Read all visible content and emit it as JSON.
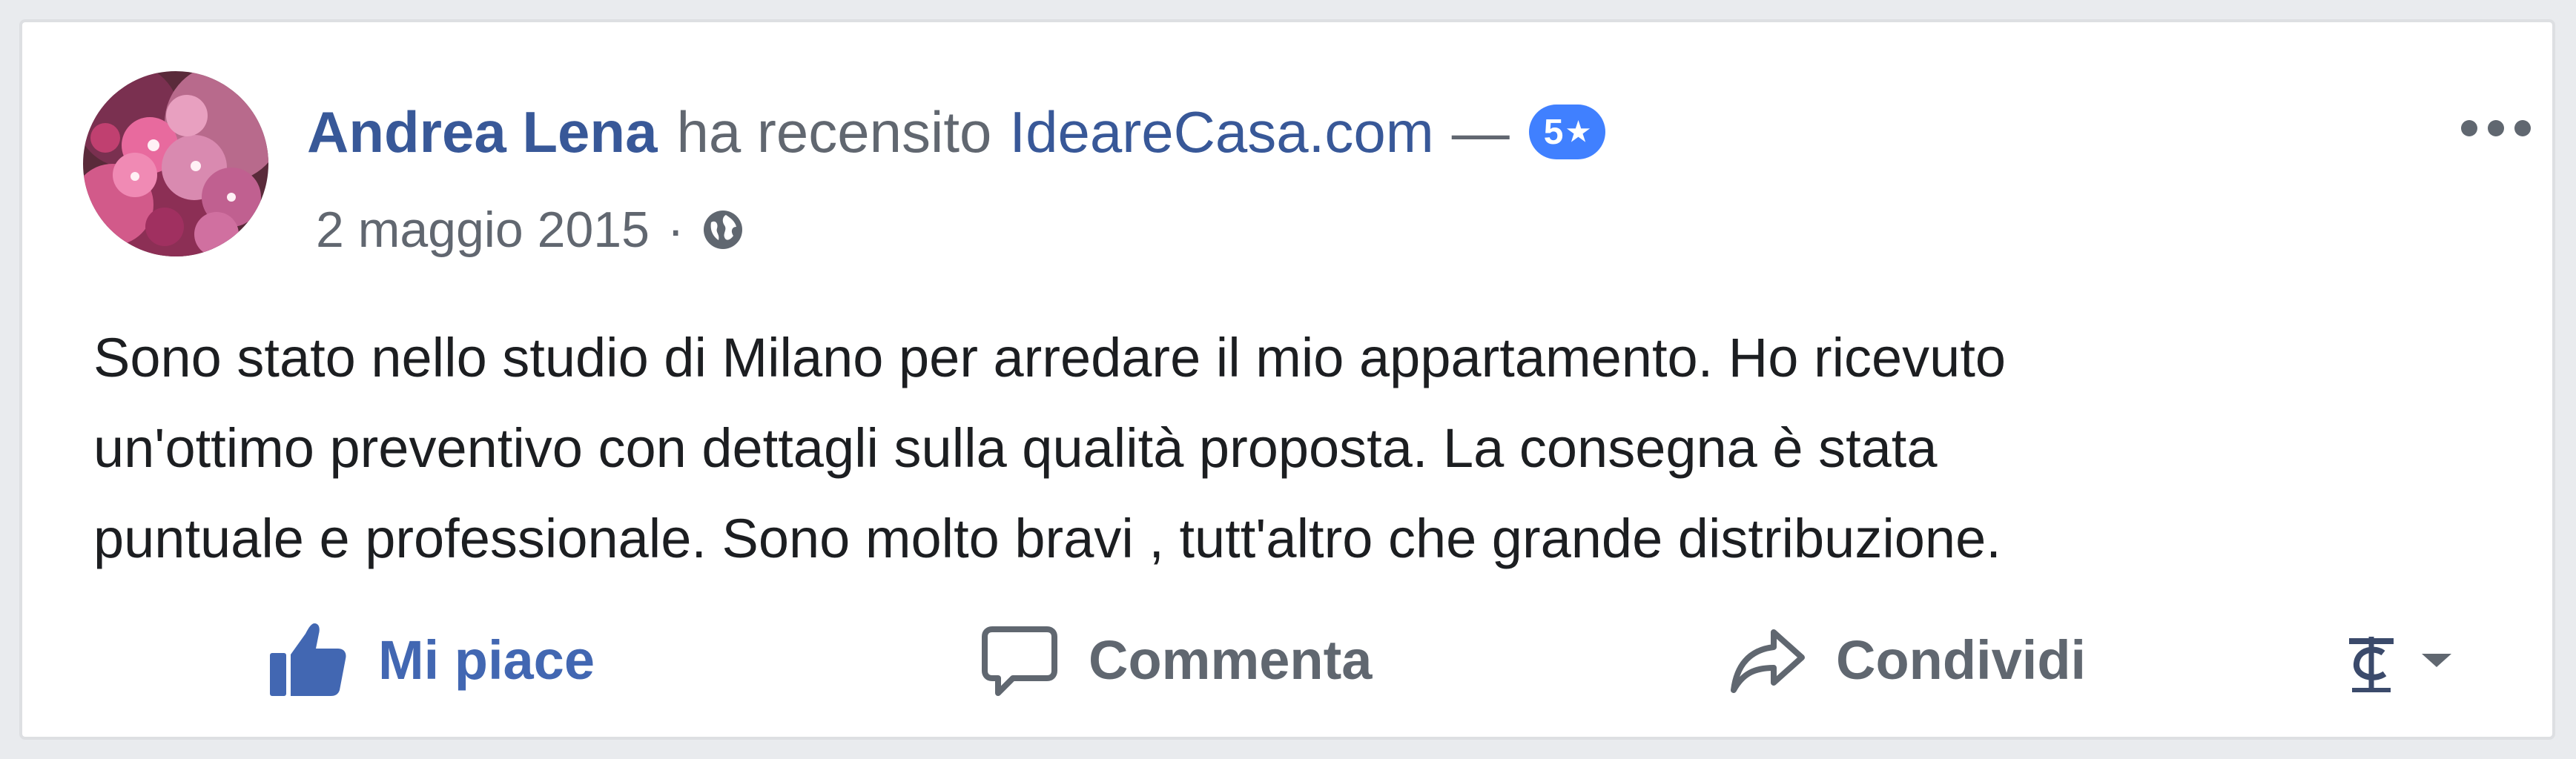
{
  "post": {
    "author": "Andrea Lena",
    "verb": "ha recensito",
    "page": "IdeareCasa.com",
    "dash": "—",
    "rating": "5",
    "rating_icon": "star-icon",
    "date": "2 maggio 2015",
    "separator": "·",
    "privacy_icon": "globe-icon",
    "text_lines": [
      "Sono stato nello studio di Milano per arredare il mio appartamento. Ho ricevuto",
      "un'ottimo preventivo con dettagli sulla qualità proposta. La consegna è stata",
      "puntuale e professionale. Sono molto bravi , tutt'altro che grande distribuzione."
    ]
  },
  "actions": {
    "like": "Mi piace",
    "comment": "Commenta",
    "share": "Condividi"
  },
  "colors": {
    "link": "#385898",
    "like_blue": "#4267b2",
    "badge": "#4080ff",
    "secondary_text": "#616770",
    "body_text": "#1c1e21"
  }
}
